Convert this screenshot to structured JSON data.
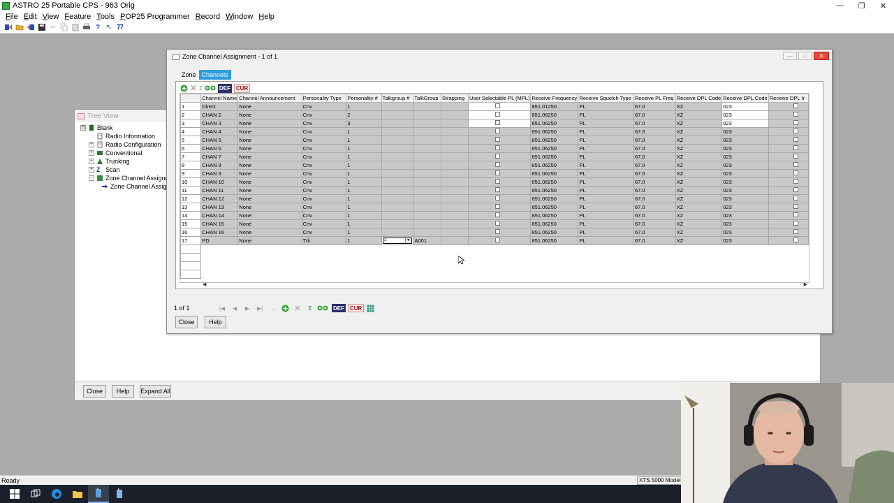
{
  "app": {
    "title": "ASTRO 25 Portable CPS - 963 Orig",
    "window_controls": [
      "—",
      "❐",
      "✕"
    ]
  },
  "menu": [
    "File",
    "Edit",
    "View",
    "Feature",
    "Tools",
    "POP25 Programmer",
    "Record",
    "Window",
    "Help"
  ],
  "tree_view": {
    "title": "Tree View",
    "nodes": [
      {
        "label": "Blank",
        "indent": 0,
        "expander": "⊟"
      },
      {
        "label": "Radio Information",
        "indent": 1,
        "expander": ""
      },
      {
        "label": "Radio Configuration",
        "indent": 1,
        "expander": "+"
      },
      {
        "label": "Conventional",
        "indent": 1,
        "expander": "+"
      },
      {
        "label": "Trunking",
        "indent": 1,
        "expander": "+"
      },
      {
        "label": "Scan",
        "indent": 1,
        "expander": "+"
      },
      {
        "label": "Zone Channel Assignme",
        "indent": 1,
        "expander": "−"
      },
      {
        "label": "Zone Channel Assign",
        "indent": 2,
        "expander": ""
      }
    ],
    "buttons": {
      "close": "Close",
      "help": "Help",
      "expand_all": "Expand All"
    }
  },
  "zca": {
    "title": "Zone Channel Assignment - 1 of 1",
    "tabs": [
      {
        "label": "Zone",
        "active": false
      },
      {
        "label": "Channels",
        "active": true
      }
    ],
    "toolbar": {
      "def": "DEF",
      "cur": "CUR"
    },
    "columns": [
      "",
      "Channel Name",
      "Channel Announcement",
      "Personality Type",
      "Personality #",
      "Talkgroup #",
      "TalkGroup",
      "Strapping",
      "User Selectable PL (MPL)",
      "Receive Frequency",
      "Receive Squelch Type",
      "Receive PL Freq",
      "Receive DPL Code",
      "Receive DPL Code",
      "Receive DPL Ir"
    ],
    "rows": [
      {
        "num": "1",
        "name": "Direct",
        "ann": "None",
        "ptype": "Cnv",
        "pnum": "1",
        "tgnum": "",
        "tg": "",
        "freq": "851.01250",
        "sq": "PL",
        "plf": "67.0",
        "dpl": "XZ",
        "dpl2": "023",
        "light": true
      },
      {
        "num": "2",
        "name": "CHAN 2",
        "ann": "None",
        "ptype": "Cnv",
        "pnum": "2",
        "tgnum": "",
        "tg": "",
        "freq": "851.06250",
        "sq": "PL",
        "plf": "67.0",
        "dpl": "XZ",
        "dpl2": "023",
        "light": true
      },
      {
        "num": "3",
        "name": "CHAN 3",
        "ann": "None",
        "ptype": "Cnv",
        "pnum": "3",
        "tgnum": "",
        "tg": "",
        "freq": "851.06250",
        "sq": "PL",
        "plf": "67.0",
        "dpl": "XZ",
        "dpl2": "023",
        "light": true
      },
      {
        "num": "4",
        "name": "CHAN 4",
        "ann": "None",
        "ptype": "Cnv",
        "pnum": "1",
        "tgnum": "",
        "tg": "",
        "freq": "851.06250",
        "sq": "PL",
        "plf": "67.0",
        "dpl": "XZ",
        "dpl2": "023",
        "light": false
      },
      {
        "num": "5",
        "name": "CHAN 5",
        "ann": "None",
        "ptype": "Cnv",
        "pnum": "1",
        "tgnum": "",
        "tg": "",
        "freq": "851.06250",
        "sq": "PL",
        "plf": "67.0",
        "dpl": "XZ",
        "dpl2": "023",
        "light": false
      },
      {
        "num": "6",
        "name": "CHAN 6",
        "ann": "None",
        "ptype": "Cnv",
        "pnum": "1",
        "tgnum": "",
        "tg": "",
        "freq": "851.06250",
        "sq": "PL",
        "plf": "67.0",
        "dpl": "XZ",
        "dpl2": "023",
        "light": false
      },
      {
        "num": "7",
        "name": "CHAN 7",
        "ann": "None",
        "ptype": "Cnv",
        "pnum": "1",
        "tgnum": "",
        "tg": "",
        "freq": "851.06250",
        "sq": "PL",
        "plf": "67.0",
        "dpl": "XZ",
        "dpl2": "023",
        "light": false
      },
      {
        "num": "8",
        "name": "CHAN 8",
        "ann": "None",
        "ptype": "Cnv",
        "pnum": "1",
        "tgnum": "",
        "tg": "",
        "freq": "851.06250",
        "sq": "PL",
        "plf": "67.0",
        "dpl": "XZ",
        "dpl2": "023",
        "light": false
      },
      {
        "num": "9",
        "name": "CHAN 9",
        "ann": "None",
        "ptype": "Cnv",
        "pnum": "1",
        "tgnum": "",
        "tg": "",
        "freq": "851.06250",
        "sq": "PL",
        "plf": "67.0",
        "dpl": "XZ",
        "dpl2": "023",
        "light": false
      },
      {
        "num": "10",
        "name": "CHAN 10",
        "ann": "None",
        "ptype": "Cnv",
        "pnum": "1",
        "tgnum": "",
        "tg": "",
        "freq": "851.06250",
        "sq": "PL",
        "plf": "67.0",
        "dpl": "XZ",
        "dpl2": "023",
        "light": false
      },
      {
        "num": "11",
        "name": "CHAN 11",
        "ann": "None",
        "ptype": "Cnv",
        "pnum": "1",
        "tgnum": "",
        "tg": "",
        "freq": "851.06250",
        "sq": "PL",
        "plf": "67.0",
        "dpl": "XZ",
        "dpl2": "023",
        "light": false
      },
      {
        "num": "12",
        "name": "CHAN 12",
        "ann": "None",
        "ptype": "Cnv",
        "pnum": "1",
        "tgnum": "",
        "tg": "",
        "freq": "851.06250",
        "sq": "PL",
        "plf": "67.0",
        "dpl": "XZ",
        "dpl2": "023",
        "light": false
      },
      {
        "num": "13",
        "name": "CHAN 13",
        "ann": "None",
        "ptype": "Cnv",
        "pnum": "1",
        "tgnum": "",
        "tg": "",
        "freq": "851.06250",
        "sq": "PL",
        "plf": "67.0",
        "dpl": "XZ",
        "dpl2": "023",
        "light": false
      },
      {
        "num": "14",
        "name": "CHAN 14",
        "ann": "None",
        "ptype": "Cnv",
        "pnum": "1",
        "tgnum": "",
        "tg": "",
        "freq": "851.06250",
        "sq": "PL",
        "plf": "67.0",
        "dpl": "XZ",
        "dpl2": "023",
        "light": false
      },
      {
        "num": "15",
        "name": "CHAN 15",
        "ann": "None",
        "ptype": "Cnv",
        "pnum": "1",
        "tgnum": "",
        "tg": "",
        "freq": "851.06250",
        "sq": "PL",
        "plf": "67.0",
        "dpl": "XZ",
        "dpl2": "023",
        "light": false
      },
      {
        "num": "16",
        "name": "CHAN 16",
        "ann": "None",
        "ptype": "Cnv",
        "pnum": "1",
        "tgnum": "",
        "tg": "",
        "freq": "851.06250",
        "sq": "PL",
        "plf": "67.0",
        "dpl": "XZ",
        "dpl2": "023",
        "light": false
      },
      {
        "num": "17",
        "name": "PD",
        "ann": "None",
        "ptype": "Trk",
        "pnum": "1",
        "tgnum": "1",
        "tg": "A001",
        "freq": "851.06250",
        "sq": "PL",
        "plf": "67.0",
        "dpl": "XZ",
        "dpl2": "023",
        "light": false
      }
    ],
    "page_label": "1 of 1",
    "buttons": {
      "close": "Close",
      "help": "Help"
    }
  },
  "status": {
    "left": "Ready",
    "right": "XTS 5000 Model II"
  }
}
